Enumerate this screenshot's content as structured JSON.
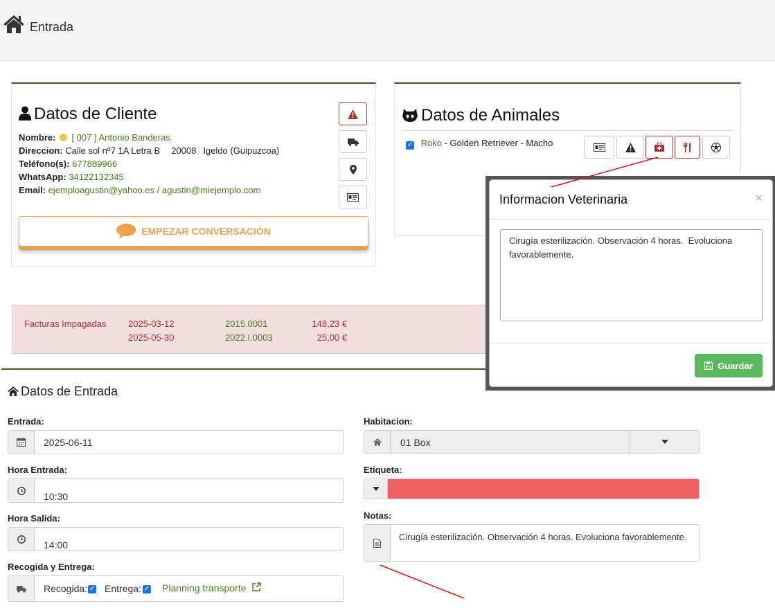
{
  "header": {
    "title": "Entrada",
    "icon": "home-icon"
  },
  "client": {
    "title": "Datos de Cliente",
    "nombre_label": "Nombre:",
    "nombre_value": "[ 007 ] Antonio Banderas",
    "direccion_label": "Direccion:",
    "direccion_value": "Calle sol nº7 1A Letra B",
    "cp": "20008",
    "ciudad": "Igeldo (Guipuzcoa)",
    "telefono_label": "Teléfono(s):",
    "telefono_value": "677889966",
    "whatsapp_label": "WhatsApp:",
    "whatsapp_value": "34122132345",
    "email_label": "Email:",
    "email_value": "ejemploagustin@yahoo.es / agustin@miejemplo.com",
    "conversation_button": "EMPEZAR CONVERSACIÓN",
    "status_dot_color": "#e8c84a"
  },
  "animals": {
    "title": "Datos de Animales",
    "row": {
      "name": "Roko",
      "details": " - Golden Retriever - Macho",
      "checked": true
    }
  },
  "invoices": {
    "label": "Facturas Impagadas",
    "rows": [
      {
        "date": "2025-03-12",
        "number": "2015.0001",
        "amount": "148,23 €"
      },
      {
        "date": "2025-05-30",
        "number": "2022.I.0003",
        "amount": "25,00 €"
      }
    ]
  },
  "entry": {
    "title": "Datos de Entrada",
    "entrada_label": "Entrada:",
    "entrada_value": "2025-06-11",
    "hora_entrada_label": "Hora Entrada:",
    "hora_entrada_value": "10:30",
    "hora_salida_label": "Hora Salida:",
    "hora_salida_value": "14:00",
    "recogida_entrega_label": "Recogida y Entrega:",
    "recogida_label": "Recogida:",
    "entrega_label": "Entrega:",
    "planning_link": "Planning transporte",
    "habitacion_label": "Habitacion:",
    "habitacion_value": "01 Box",
    "etiqueta_label": "Etiqueta:",
    "etiqueta_color": "#f26161",
    "notas_label": "Notas:",
    "notas_value": "Cirugía esterilización. Observación 4 horas.  Evoluciona favorablemente."
  },
  "modal": {
    "title": "Informacion Veterinaria",
    "close": "×",
    "text": "Cirugía esterilización. Observación 4 horas.  Evoluciona favorablemente.",
    "save_button": "Guardar"
  }
}
